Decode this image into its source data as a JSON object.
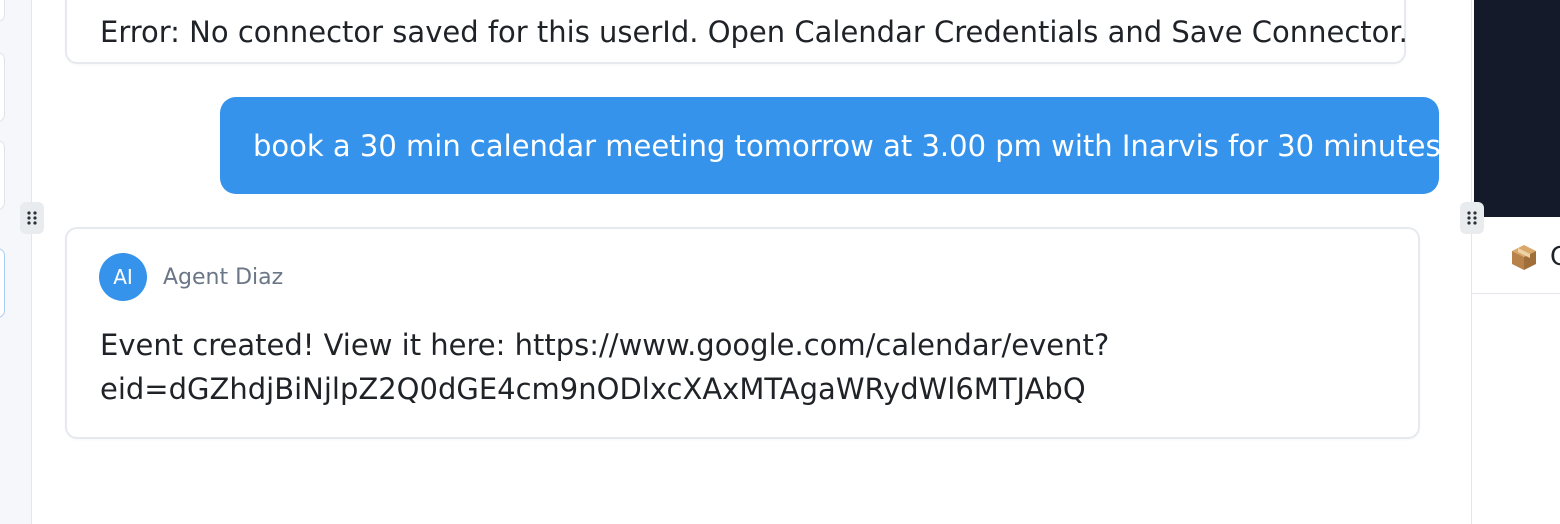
{
  "chat": {
    "error_message": "Error: No connector saved for this userId. Open Calendar Credentials and Save Connector.",
    "user_message": "book a 30 min calendar meeting tomorrow at 3.00 pm with Inarvis for 30 minutes",
    "agent": {
      "avatar_initials": "AI",
      "name": "Agent Diaz",
      "response_line1": "Event created! View it here: https://www.google.com/calendar/event?",
      "response_line2": "eid=dGZhdjBiNjlpZ2Q0dGE4cm9nODlxcXAxMTAgaWRydWl6MTJAbQ"
    }
  },
  "right_panel": {
    "item_icon": "package-icon",
    "item_label": "C"
  },
  "colors": {
    "accent": "#3593ec",
    "dark_preview": "#141a29",
    "muted_text": "#6b7787"
  }
}
